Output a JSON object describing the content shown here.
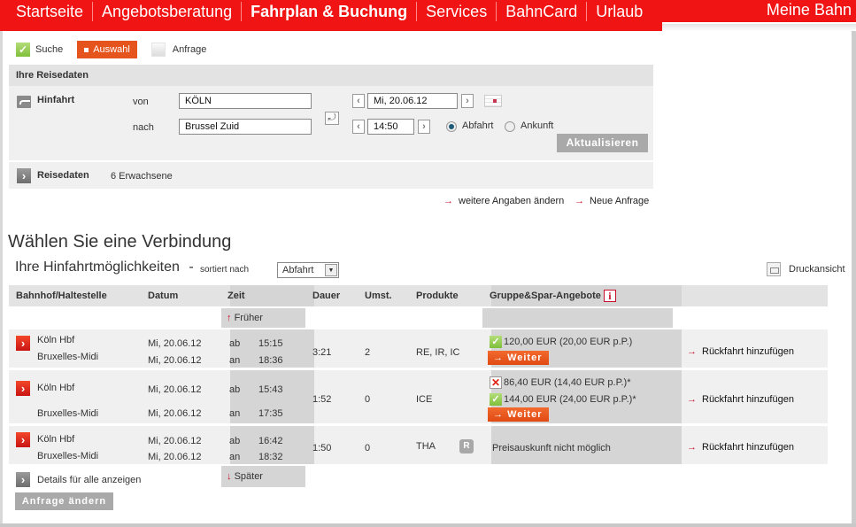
{
  "topnav": {
    "items": [
      "Startseite",
      "Angebotsberatung",
      "Fahrplan & Buchung",
      "Services",
      "BahnCard",
      "Urlaub"
    ],
    "active_index": 2,
    "meine_bahn": "Meine Bahn"
  },
  "steps": {
    "search": "Suche",
    "select": "Auswahl",
    "request": "Anfrage"
  },
  "reisedaten": {
    "title": "Ihre Reisedaten",
    "hinfahrt_label": "Hinfahrt",
    "von_label": "von",
    "von_value": "KÖLN",
    "nach_label": "nach",
    "nach_value": "Brussel Zuid",
    "date_value": "Mi, 20.06.12",
    "time_value": "14:50",
    "abfahrt_label": "Abfahrt",
    "ankunft_label": "Ankunft",
    "selected_mode": "Abfahrt",
    "update_button": "Aktualisieren",
    "travelers_label": "Reisedaten",
    "travelers_value": "6 Erwachsene"
  },
  "links": {
    "more_details": "weitere Angaben ändern",
    "new_request": "Neue Anfrage"
  },
  "results": {
    "heading": "Wählen Sie eine Verbindung",
    "subheading": "Ihre Hinfahrtmöglichkeiten",
    "dash": "-",
    "sorted_by_label": "sortiert nach",
    "sort_value": "Abfahrt",
    "print_label": "Druckansicht",
    "columns": {
      "station": "Bahnhof/Haltestelle",
      "date": "Datum",
      "time": "Zeit",
      "duration": "Dauer",
      "changes": "Umst.",
      "products": "Produkte",
      "offers": "Gruppe&Spar-Angebote"
    },
    "earlier": "Früher",
    "later": "Später",
    "connections": [
      {
        "from": "Köln Hbf",
        "to": "Bruxelles-Midi",
        "date_from": "Mi, 20.06.12",
        "date_to": "Mi, 20.06.12",
        "dep_label": "ab",
        "dep": "15:15",
        "arr_label": "an",
        "arr": "18:36",
        "duration": "3:21",
        "changes": "2",
        "products": "RE, IR, IC",
        "offers": [
          {
            "status": "ok",
            "text": "120,00 EUR (20,00 EUR p.P.)"
          }
        ],
        "continue": "Weiter",
        "return_link": "Rückfahrt hinzufügen"
      },
      {
        "from": "Köln Hbf",
        "to": "Bruxelles-Midi",
        "date_from": "Mi, 20.06.12",
        "date_to": "Mi, 20.06.12",
        "dep_label": "ab",
        "dep": "15:43",
        "arr_label": "an",
        "arr": "17:35",
        "duration": "1:52",
        "changes": "0",
        "products": "ICE",
        "offers": [
          {
            "status": "unavailable",
            "text": "86,40 EUR (14,40 EUR p.P.)*"
          },
          {
            "status": "ok",
            "text": "144,00 EUR (24,00 EUR p.P.)*"
          }
        ],
        "continue": "Weiter",
        "return_link": "Rückfahrt hinzufügen"
      },
      {
        "from": "Köln Hbf",
        "to": "Bruxelles-Midi",
        "date_from": "Mi, 20.06.12",
        "date_to": "Mi, 20.06.12",
        "dep_label": "ab",
        "dep": "16:42",
        "arr_label": "an",
        "arr": "18:32",
        "duration": "1:50",
        "changes": "0",
        "products": "THA",
        "reservation_icon": "R",
        "price_info": "Preisauskunft nicht möglich",
        "return_link": "Rückfahrt hinzufügen"
      }
    ],
    "details_all": "Details für alle anzeigen",
    "change_request_button": "Anfrage ändern"
  },
  "colors": {
    "brand_red": "#f01414",
    "active_step": "#e6541e",
    "continue_button": "#e8561a",
    "ok_green": "#8cc63f"
  }
}
